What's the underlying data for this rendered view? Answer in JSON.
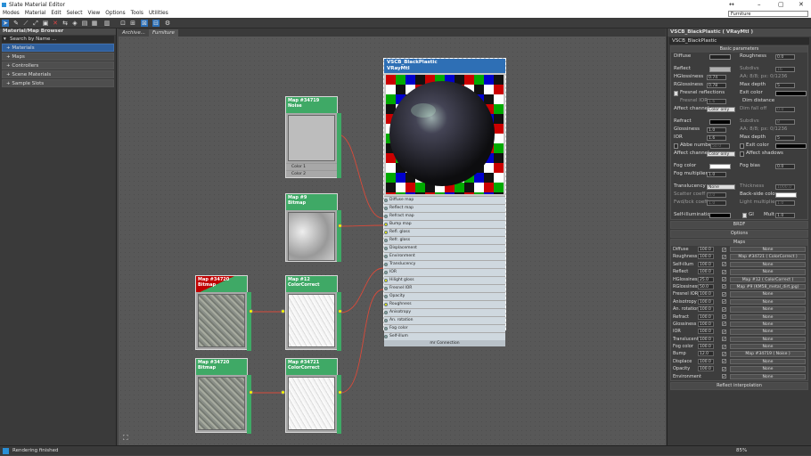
{
  "title": "Slate Material Editor",
  "window_controls": {
    "min": "–",
    "max": "▢",
    "close": "✕",
    "extra": "↔"
  },
  "menu": [
    "Modes",
    "Material",
    "Edit",
    "Select",
    "View",
    "Options",
    "Tools",
    "Utilities"
  ],
  "view_selector": "Furniture",
  "left_panel": {
    "header": "Material/Map Browser",
    "search_placeholder": "Search by Name ...",
    "categories": [
      "+ Materials",
      "+ Maps",
      "+ Controllers",
      "+ Scene Materials",
      "+ Sample Slots"
    ]
  },
  "view_tabs": [
    "Archive...",
    "Furniture"
  ],
  "nodes": {
    "noise": {
      "id": "Map #34719",
      "type": "Noise",
      "slots": [
        "Color 1",
        "Color 2"
      ]
    },
    "bitmap9": {
      "id": "Map #9",
      "type": "Bitmap"
    },
    "bitmap_red": {
      "id": "Map #34720",
      "type": "Bitmap"
    },
    "cc12": {
      "id": "Map #12",
      "type": "ColorCorrect"
    },
    "bitmap_bottom": {
      "id": "Map #34720",
      "type": "Bitmap"
    },
    "cc34721": {
      "id": "Map #34721",
      "type": "ColorCorrect"
    }
  },
  "material_node": {
    "name": "VSCB_BlackPlastic",
    "type": "VRayMtl",
    "slots": [
      "Diffuse map",
      "Reflect map",
      "Refract map",
      "Bump map",
      "Refl. gloss",
      "Refr. gloss",
      "Displacement",
      "Environment",
      "Translucency",
      "IOR",
      "Hilight gloss",
      "Fresnel IOR",
      "Opacity",
      "Roughness",
      "Anisotropy",
      "An. rotation",
      "Fog color",
      "Self-illum"
    ],
    "connected_slots": [
      3,
      4,
      10,
      13
    ],
    "footer": "mr Connection"
  },
  "right_panel": {
    "header": "VSCB_BlackPlastic  ( VRayMtl )",
    "name_field": "VSCB_BlackPlastic",
    "basic_params": "Basic parameters",
    "diffuse": {
      "label": "Diffuse",
      "roughness_label": "Roughness",
      "roughness": "0.0"
    },
    "reflect": {
      "label": "Reflect",
      "subdivs_label": "Subdivs",
      "subdivs": "16",
      "hgloss_label": "HGlossiness",
      "hgloss": "0.74",
      "rgloss_label": "RGlossiness",
      "rgloss": "0.78",
      "aa_label": "AA: 8/8; px: 0/1236",
      "maxdepth_label": "Max depth",
      "maxdepth": "5",
      "fresnel": "Fresnel reflections",
      "exit_color": "Exit color",
      "fresnel_ior_label": "Fresnel IOR",
      "fresnel_ior": "1.6",
      "dim_distance": "Dim distance",
      "affect_label": "Affect channels",
      "affect": "Color only",
      "dim_falloff": "Dim fall off",
      "dim_falloff_val": "0.0"
    },
    "refract": {
      "label": "Refract",
      "subdivs_label": "Subdivs",
      "subdivs": "8",
      "gloss_label": "Glossiness",
      "gloss": "1.0",
      "aa_label": "AA: 8/8; px: 0/1236",
      "ior_label": "IOR",
      "ior": "1.6",
      "maxdepth_label": "Max depth",
      "maxdepth": "5",
      "abbe": "Abbe number",
      "abbe_val": "50.0",
      "exit": "Exit color",
      "affect_label": "Affect channels",
      "affect": "Color only",
      "affect_shadows": "Affect shadows"
    },
    "fog": {
      "color_label": "Fog color",
      "bias_label": "Fog bias",
      "bias": "0.0",
      "mult_label": "Fog multiplier",
      "mult": "1.0"
    },
    "translucency": {
      "label": "Translucency",
      "mode": "None",
      "thickness_label": "Thickness",
      "thickness": "1000.0",
      "scatter_label": "Scatter coeff",
      "scatter": "0.0",
      "back_label": "Back-side color",
      "fwdbck_label": "Fwd/bck coeff",
      "fwdbck": "1.0",
      "light_label": "Light multiplier",
      "light": "1.0"
    },
    "selfillum": {
      "label": "Self-illumination",
      "gi": "GI",
      "mult_label": "Mult",
      "mult": "1.0"
    },
    "brdf": "BRDF",
    "options": "Options",
    "maps": "Maps",
    "map_rows": [
      {
        "name": "Diffuse",
        "val": "100.0",
        "map": "None"
      },
      {
        "name": "Roughness",
        "val": "100.0",
        "map": "Map #34721  ( ColorCorrect )"
      },
      {
        "name": "Self-illum",
        "val": "100.0",
        "map": "None"
      },
      {
        "name": "Reflect",
        "val": "100.0",
        "map": "None"
      },
      {
        "name": "HGlossiness",
        "val": "25.0",
        "map": "Map #12  ( ColorCorrect )"
      },
      {
        "name": "RGlossiness",
        "val": "50.0",
        "map": "Map #9 (KM58_metal_dirt.jpg)"
      },
      {
        "name": "Fresnel IOR",
        "val": "100.0",
        "map": "None"
      },
      {
        "name": "Anisotropy",
        "val": "100.0",
        "map": "None"
      },
      {
        "name": "An. rotation",
        "val": "100.0",
        "map": "None"
      },
      {
        "name": "Refract",
        "val": "100.0",
        "map": "None"
      },
      {
        "name": "Glossiness",
        "val": "100.0",
        "map": "None"
      },
      {
        "name": "IOR",
        "val": "100.0",
        "map": "None"
      },
      {
        "name": "Translucent",
        "val": "100.0",
        "map": "None"
      },
      {
        "name": "Fog color",
        "val": "100.0",
        "map": "None"
      },
      {
        "name": "Bump",
        "val": "12.0",
        "map": "Map #34719  ( Noise )"
      },
      {
        "name": "Displace",
        "val": "100.0",
        "map": "None"
      },
      {
        "name": "Opacity",
        "val": "100.0",
        "map": "None"
      },
      {
        "name": "Environment",
        "val": "",
        "map": "None"
      }
    ],
    "reflect_interp": "Reflect interpolation"
  },
  "status": "Rendering finished",
  "zoom": "85%",
  "colors": {
    "node_header": "#3fa966",
    "material_header": "#2e6fb5",
    "wire": "#d84a3a",
    "port": "#f4f400",
    "selection": "#2f5f9c"
  }
}
